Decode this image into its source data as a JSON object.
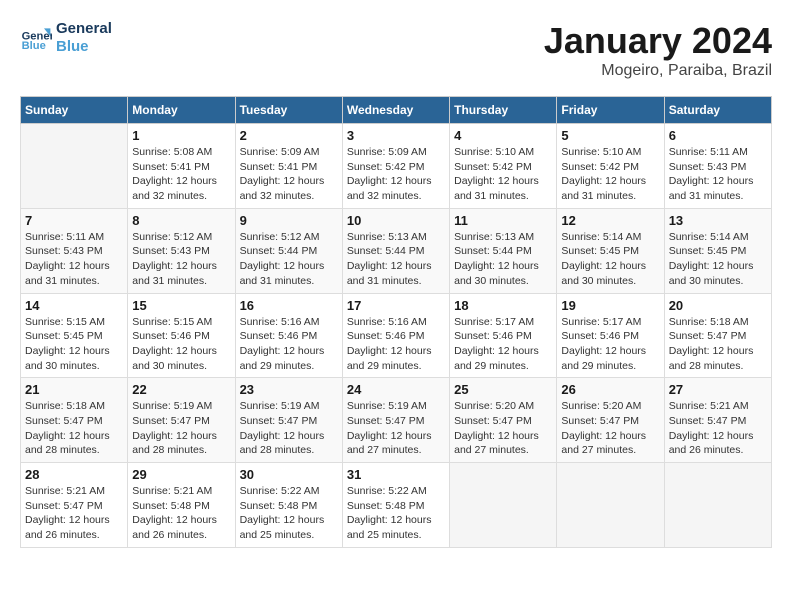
{
  "header": {
    "logo_line1": "General",
    "logo_line2": "Blue",
    "month": "January 2024",
    "location": "Mogeiro, Paraiba, Brazil"
  },
  "days_of_week": [
    "Sunday",
    "Monday",
    "Tuesday",
    "Wednesday",
    "Thursday",
    "Friday",
    "Saturday"
  ],
  "weeks": [
    [
      {
        "day": "",
        "info": ""
      },
      {
        "day": "1",
        "info": "Sunrise: 5:08 AM\nSunset: 5:41 PM\nDaylight: 12 hours\nand 32 minutes."
      },
      {
        "day": "2",
        "info": "Sunrise: 5:09 AM\nSunset: 5:41 PM\nDaylight: 12 hours\nand 32 minutes."
      },
      {
        "day": "3",
        "info": "Sunrise: 5:09 AM\nSunset: 5:42 PM\nDaylight: 12 hours\nand 32 minutes."
      },
      {
        "day": "4",
        "info": "Sunrise: 5:10 AM\nSunset: 5:42 PM\nDaylight: 12 hours\nand 31 minutes."
      },
      {
        "day": "5",
        "info": "Sunrise: 5:10 AM\nSunset: 5:42 PM\nDaylight: 12 hours\nand 31 minutes."
      },
      {
        "day": "6",
        "info": "Sunrise: 5:11 AM\nSunset: 5:43 PM\nDaylight: 12 hours\nand 31 minutes."
      }
    ],
    [
      {
        "day": "7",
        "info": "Sunrise: 5:11 AM\nSunset: 5:43 PM\nDaylight: 12 hours\nand 31 minutes."
      },
      {
        "day": "8",
        "info": "Sunrise: 5:12 AM\nSunset: 5:43 PM\nDaylight: 12 hours\nand 31 minutes."
      },
      {
        "day": "9",
        "info": "Sunrise: 5:12 AM\nSunset: 5:44 PM\nDaylight: 12 hours\nand 31 minutes."
      },
      {
        "day": "10",
        "info": "Sunrise: 5:13 AM\nSunset: 5:44 PM\nDaylight: 12 hours\nand 31 minutes."
      },
      {
        "day": "11",
        "info": "Sunrise: 5:13 AM\nSunset: 5:44 PM\nDaylight: 12 hours\nand 30 minutes."
      },
      {
        "day": "12",
        "info": "Sunrise: 5:14 AM\nSunset: 5:45 PM\nDaylight: 12 hours\nand 30 minutes."
      },
      {
        "day": "13",
        "info": "Sunrise: 5:14 AM\nSunset: 5:45 PM\nDaylight: 12 hours\nand 30 minutes."
      }
    ],
    [
      {
        "day": "14",
        "info": "Sunrise: 5:15 AM\nSunset: 5:45 PM\nDaylight: 12 hours\nand 30 minutes."
      },
      {
        "day": "15",
        "info": "Sunrise: 5:15 AM\nSunset: 5:46 PM\nDaylight: 12 hours\nand 30 minutes."
      },
      {
        "day": "16",
        "info": "Sunrise: 5:16 AM\nSunset: 5:46 PM\nDaylight: 12 hours\nand 29 minutes."
      },
      {
        "day": "17",
        "info": "Sunrise: 5:16 AM\nSunset: 5:46 PM\nDaylight: 12 hours\nand 29 minutes."
      },
      {
        "day": "18",
        "info": "Sunrise: 5:17 AM\nSunset: 5:46 PM\nDaylight: 12 hours\nand 29 minutes."
      },
      {
        "day": "19",
        "info": "Sunrise: 5:17 AM\nSunset: 5:46 PM\nDaylight: 12 hours\nand 29 minutes."
      },
      {
        "day": "20",
        "info": "Sunrise: 5:18 AM\nSunset: 5:47 PM\nDaylight: 12 hours\nand 28 minutes."
      }
    ],
    [
      {
        "day": "21",
        "info": "Sunrise: 5:18 AM\nSunset: 5:47 PM\nDaylight: 12 hours\nand 28 minutes."
      },
      {
        "day": "22",
        "info": "Sunrise: 5:19 AM\nSunset: 5:47 PM\nDaylight: 12 hours\nand 28 minutes."
      },
      {
        "day": "23",
        "info": "Sunrise: 5:19 AM\nSunset: 5:47 PM\nDaylight: 12 hours\nand 28 minutes."
      },
      {
        "day": "24",
        "info": "Sunrise: 5:19 AM\nSunset: 5:47 PM\nDaylight: 12 hours\nand 27 minutes."
      },
      {
        "day": "25",
        "info": "Sunrise: 5:20 AM\nSunset: 5:47 PM\nDaylight: 12 hours\nand 27 minutes."
      },
      {
        "day": "26",
        "info": "Sunrise: 5:20 AM\nSunset: 5:47 PM\nDaylight: 12 hours\nand 27 minutes."
      },
      {
        "day": "27",
        "info": "Sunrise: 5:21 AM\nSunset: 5:47 PM\nDaylight: 12 hours\nand 26 minutes."
      }
    ],
    [
      {
        "day": "28",
        "info": "Sunrise: 5:21 AM\nSunset: 5:47 PM\nDaylight: 12 hours\nand 26 minutes."
      },
      {
        "day": "29",
        "info": "Sunrise: 5:21 AM\nSunset: 5:48 PM\nDaylight: 12 hours\nand 26 minutes."
      },
      {
        "day": "30",
        "info": "Sunrise: 5:22 AM\nSunset: 5:48 PM\nDaylight: 12 hours\nand 25 minutes."
      },
      {
        "day": "31",
        "info": "Sunrise: 5:22 AM\nSunset: 5:48 PM\nDaylight: 12 hours\nand 25 minutes."
      },
      {
        "day": "",
        "info": ""
      },
      {
        "day": "",
        "info": ""
      },
      {
        "day": "",
        "info": ""
      }
    ]
  ]
}
